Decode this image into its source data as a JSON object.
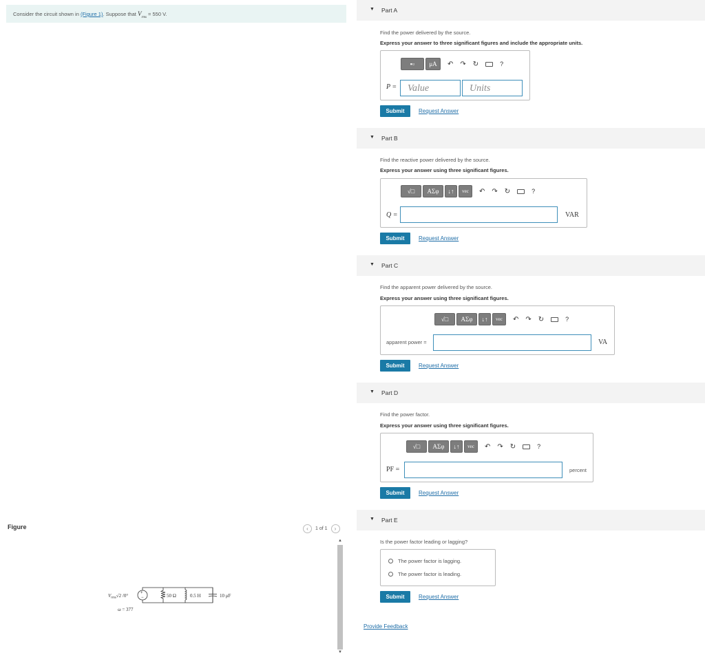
{
  "problem": {
    "text_before": "Consider the circuit shown in ",
    "figure_link": "(Figure 1)",
    "text_after": ". Suppose that ",
    "var": "V",
    "sub": "rms",
    "value": " = 550 V."
  },
  "figure": {
    "label": "Figure",
    "pager_text": "1 of 1",
    "circuit": {
      "source_label": "V",
      "source_sub": "rms",
      "source_rest": "√2 /0°",
      "omega": "ω = 377",
      "r": "50 Ω",
      "l": "0.5 H",
      "c": "10 μF"
    }
  },
  "parts": [
    {
      "title": "Part A",
      "question": "Find the power delivered by the source.",
      "instruction": "Express your answer to three significant figures and include the appropriate units.",
      "var": "P =",
      "value_placeholder": "Value",
      "units_placeholder": "Units",
      "toolbar": [
        "μA"
      ],
      "submit": "Submit",
      "request": "Request Answer"
    },
    {
      "title": "Part B",
      "question": "Find the reactive power delivered by the source.",
      "instruction": "Express your answer using three significant figures.",
      "var": "Q =",
      "unit": "VAR",
      "toolbar": [
        "√□",
        "ΑΣφ",
        "↓↑",
        "vec"
      ],
      "submit": "Submit",
      "request": "Request Answer"
    },
    {
      "title": "Part C",
      "question": "Find the apparent power delivered by the source.",
      "instruction": "Express your answer using three significant figures.",
      "var": "apparent power =",
      "unit": "VA",
      "toolbar": [
        "√□",
        "ΑΣφ",
        "↓↑",
        "vec"
      ],
      "submit": "Submit",
      "request": "Request Answer"
    },
    {
      "title": "Part D",
      "question": "Find the power factor.",
      "instruction": "Express your answer using three significant figures.",
      "var": "PF =",
      "unit": "percent",
      "toolbar": [
        "√□",
        "ΑΣφ",
        "↓↑",
        "vec"
      ],
      "submit": "Submit",
      "request": "Request Answer"
    },
    {
      "title": "Part E",
      "question": "Is the power factor leading or lagging?",
      "options": [
        "The power factor is lagging.",
        "The power factor is leading."
      ],
      "submit": "Submit",
      "request": "Request Answer"
    }
  ],
  "toolbar_common": {
    "help": "?"
  },
  "feedback": "Provide Feedback"
}
